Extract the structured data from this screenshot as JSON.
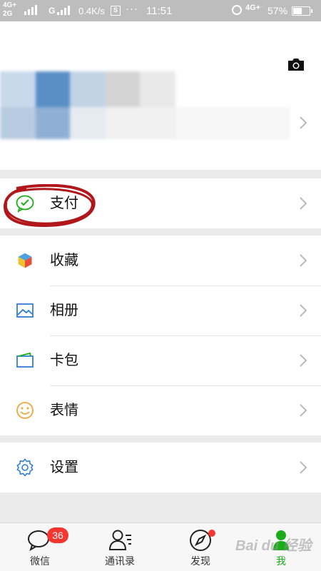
{
  "status_bar": {
    "network_left": "4G+",
    "network_left2": "2G",
    "carrier_g": "G",
    "speed": "0.4K/s",
    "s_icon": "S",
    "dots": "···",
    "time": "11:51",
    "network_right": "4G+",
    "battery_pct": "57%",
    "battery_level": 0.57
  },
  "profile": {
    "camera_icon": "camera-icon"
  },
  "menu": {
    "pay": {
      "label": "支付",
      "icon": "wechat-pay-icon",
      "color": "#1aad19"
    },
    "items": [
      {
        "label": "收藏",
        "icon": "cube-icon"
      },
      {
        "label": "相册",
        "icon": "photo-album-icon",
        "color": "#2f7fd6"
      },
      {
        "label": "卡包",
        "icon": "card-wallet-icon",
        "color": "#2f7fd6"
      },
      {
        "label": "表情",
        "icon": "smiley-icon",
        "color": "#f2a53a"
      }
    ],
    "settings": {
      "label": "设置",
      "icon": "gear-icon",
      "color": "#2f7fd6"
    }
  },
  "tabbar": {
    "tabs": [
      {
        "label": "微信",
        "icon": "chat-bubble-icon",
        "badge": "36"
      },
      {
        "label": "通讯录",
        "icon": "contacts-icon"
      },
      {
        "label": "发现",
        "icon": "compass-icon"
      },
      {
        "label": "我",
        "icon": "person-icon",
        "active": true
      }
    ],
    "active_color": "#1aad19"
  },
  "watermark": "Bai du 经验"
}
